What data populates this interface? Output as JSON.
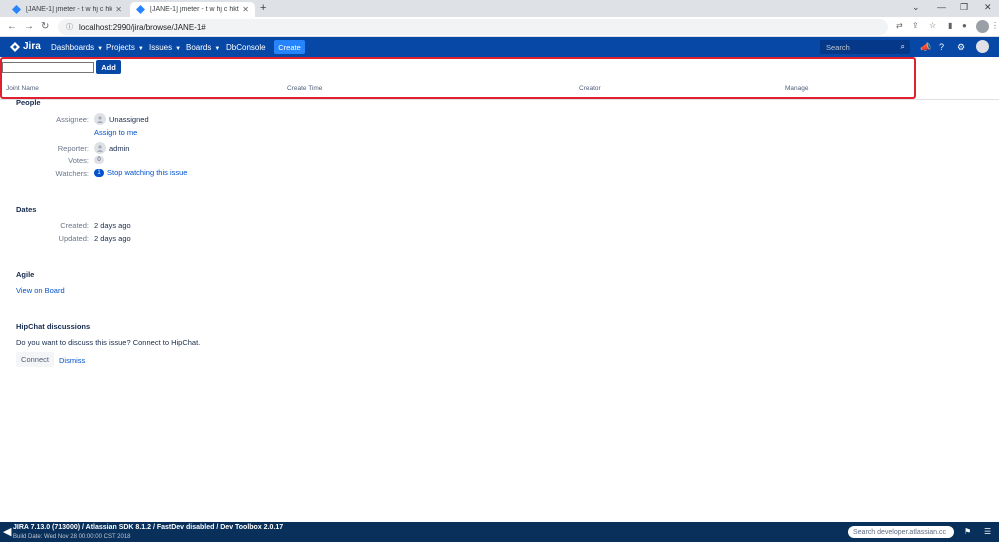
{
  "browser": {
    "tabs": [
      {
        "title": "[JANE-1] jmeter - t w hj c hktz...",
        "active": false
      },
      {
        "title": "[JANE-1] jmeter - t w hj c hktz...",
        "active": true
      }
    ],
    "new_tab": "+",
    "url": "localhost:2990/jira/browse/JANE-1#"
  },
  "jira_header": {
    "logo": "Jira",
    "nav": [
      {
        "label": "Dashboards",
        "dropdown": true
      },
      {
        "label": "Projects",
        "dropdown": true
      },
      {
        "label": "Issues",
        "dropdown": true
      },
      {
        "label": "Boards",
        "dropdown": true
      },
      {
        "label": "DbConsole",
        "dropdown": false
      }
    ],
    "create_label": "Create",
    "search_placeholder": "Search"
  },
  "panel": {
    "input_value": "",
    "add_label": "Add",
    "columns": [
      "Joint Name",
      "Create Time",
      "Creator",
      "Manage"
    ]
  },
  "people": {
    "heading": "People",
    "assignee_label": "Assignee:",
    "assignee_value": "Unassigned",
    "assign_to_me": "Assign to me",
    "reporter_label": "Reporter:",
    "reporter_value": "admin",
    "votes_label": "Votes:",
    "votes_count": "0",
    "watchers_label": "Watchers:",
    "watchers_count": "1",
    "stop_watching": "Stop watching this issue"
  },
  "dates": {
    "heading": "Dates",
    "created_label": "Created:",
    "created_value": "2 days ago",
    "updated_label": "Updated:",
    "updated_value": "2 days ago"
  },
  "agile": {
    "heading": "Agile",
    "view_on_board": "View on Board"
  },
  "hipchat": {
    "heading": "HipChat discussions",
    "prompt": "Do you want to discuss this issue? Connect to HipChat.",
    "connect_label": "Connect",
    "dismiss_label": "Dismiss"
  },
  "footer": {
    "line1": "JIRA 7.13.0 (713000) / Atlassian SDK 8.1.2 / FastDev disabled / Dev Toolbox 2.0.17",
    "line2": "Build Date: Wed Nov 28 00:00:00 CST 2018",
    "search_placeholder": "Search developer.atlassian.cc"
  },
  "colors": {
    "jira_blue": "#0747a6",
    "link_blue": "#0052cc",
    "highlight_red": "#e0202e"
  }
}
